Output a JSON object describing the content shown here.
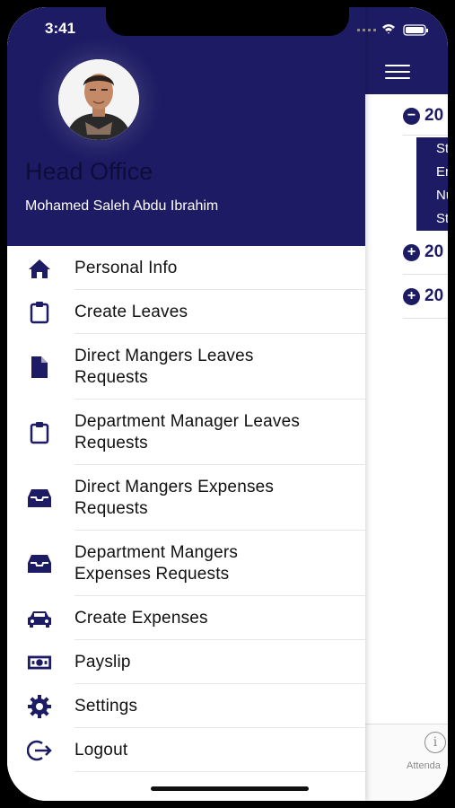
{
  "status_bar": {
    "time": "3:41"
  },
  "drawer": {
    "org_title": "Head Office",
    "user_name": "Mohamed Saleh Abdu Ibrahim",
    "menu": [
      {
        "label": "Personal Info",
        "icon": "home-icon"
      },
      {
        "label": "Create Leaves",
        "icon": "clipboard-icon"
      },
      {
        "label": "Direct Mangers Leaves Requests",
        "icon": "document-icon"
      },
      {
        "label": "Department Manager Leaves Requests",
        "icon": "clipboard-icon"
      },
      {
        "label": "Direct Mangers Expenses Requests",
        "icon": "inbox-icon"
      },
      {
        "label": "Department Mangers Expenses Requests",
        "icon": "inbox-icon"
      },
      {
        "label": "Create Expenses",
        "icon": "car-icon"
      },
      {
        "label": "Payslip",
        "icon": "money-icon"
      },
      {
        "label": "Settings",
        "icon": "gear-icon"
      },
      {
        "label": "Logout",
        "icon": "logout-icon"
      }
    ]
  },
  "background": {
    "accordion": [
      {
        "symbol": "−",
        "label": "20"
      },
      {
        "symbol": "+",
        "label": "20"
      },
      {
        "symbol": "+",
        "label": "20"
      }
    ],
    "panel_rows": [
      "St",
      "Er",
      "Nu",
      "St"
    ],
    "tab": {
      "label": "Attenda"
    }
  },
  "colors": {
    "primary": "#1d1b63",
    "title_dark": "#0e0d3a"
  }
}
